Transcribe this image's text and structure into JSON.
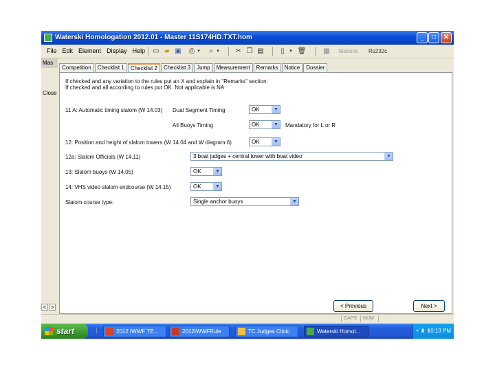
{
  "window": {
    "title": "Waterski Homologation 2012.01 - Master 11S174HD.TXT.hom",
    "buttons": {
      "minimize": "_",
      "maximize": "□",
      "close": "✕"
    }
  },
  "menu": [
    "File",
    "Edit",
    "Element",
    "Display",
    "Help"
  ],
  "toolbar": {
    "stations_label": "Stations",
    "port_label": "Rs232c"
  },
  "left_strip": {
    "tab_label": "Mas",
    "side_label": "Close",
    "arrows": [
      "<",
      ">"
    ]
  },
  "tabs": [
    {
      "label": "Competition",
      "active": false
    },
    {
      "label": "Checklist 1",
      "active": false
    },
    {
      "label": "Checklist 2",
      "active": true
    },
    {
      "label": "Checklist 3",
      "active": false
    },
    {
      "label": "Jump",
      "active": false
    },
    {
      "label": "Measurement",
      "active": false
    },
    {
      "label": "Remarks",
      "active": false
    },
    {
      "label": "Notice",
      "active": false
    },
    {
      "label": "Dossier",
      "active": false
    }
  ],
  "notes": [
    "If checked and any variation to the rules put an X and explain in \"Remarks\" section.",
    "If checked and all according to rules put OK. Not applicable is NA"
  ],
  "fields": {
    "timing_label": "11 A: Automatic timing slalom (W 14.03)",
    "dual_segment_label": "Dual Segment Timing",
    "dual_segment_value": "OK",
    "all_buoys_label": "All Buoys Timing",
    "all_buoys_value": "OK",
    "mandatory_note": "Mandatory for L or R",
    "towers_label": "12: Position and height of slalom towers (W 14.04 and W diagram 6)",
    "towers_value": "OK",
    "officials_label": "12a: Slalom Officials (W 14.11)",
    "officials_value": "3 boat judges + central tower with boat video",
    "buoys_label": "13: Slalom buoys (W 14.05)",
    "buoys_value": "OK",
    "video_label": "14: VHS video slalom endcourse (W 14.15)",
    "video_value": "OK",
    "course_type_label": "Slalom course type:",
    "course_type_value": "Single anchor buoys"
  },
  "nav": {
    "previous": "< Previous",
    "next": "Next >"
  },
  "statusbar": [
    "CAPS",
    "NUM"
  ],
  "taskbar": {
    "start": "start",
    "tasks": [
      {
        "label": "2012 IWWF TE...",
        "active": false,
        "icon_color": "#d24726"
      },
      {
        "label": "2012IWWFRule",
        "active": false,
        "icon_color": "#c43a2a"
      },
      {
        "label": "TC Judges Clinic",
        "active": false,
        "icon_color": "#f0c040"
      },
      {
        "label": "Waterski Homol...",
        "active": true,
        "icon_color": "#4aa84a"
      }
    ],
    "clock": "10:13 PM"
  }
}
